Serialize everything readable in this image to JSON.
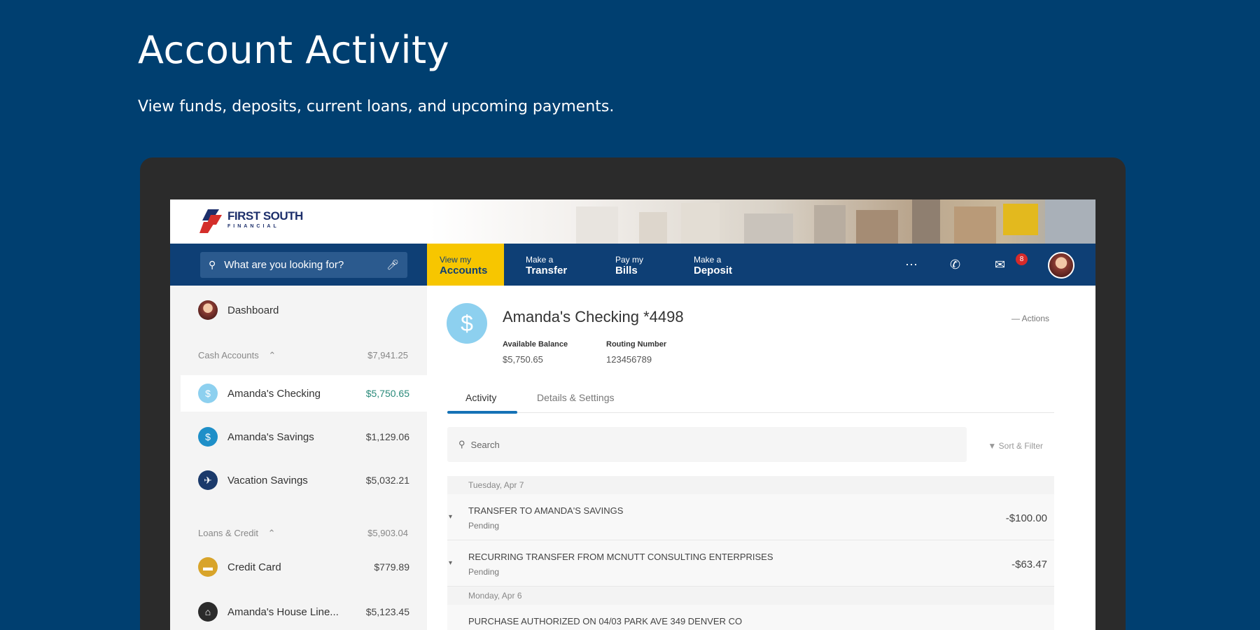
{
  "hero": {
    "title": "Account Activity",
    "subtitle": "View funds, deposits, current loans, and upcoming payments."
  },
  "brand": {
    "name": "FIRST SOUTH",
    "tagline": "FINANCIAL"
  },
  "nav": {
    "search_placeholder": "What are you looking for?",
    "items": [
      {
        "top": "View my",
        "bottom": "Accounts"
      },
      {
        "top": "Make a",
        "bottom": "Transfer"
      },
      {
        "top": "Pay my",
        "bottom": "Bills"
      },
      {
        "top": "Make a",
        "bottom": "Deposit"
      }
    ],
    "badge_count": "8"
  },
  "sidebar": {
    "dashboard": "Dashboard",
    "cash_group": {
      "label": "Cash Accounts",
      "amount": "$7,941.25"
    },
    "accounts": [
      {
        "name": "Amanda's Checking",
        "amount": "$5,750.65",
        "color": "#8dd0ef"
      },
      {
        "name": "Amanda's Savings",
        "amount": "$1,129.06",
        "color": "#1e8fc8"
      },
      {
        "name": "Vacation Savings",
        "amount": "$5,032.21",
        "color": "#1b3a6b"
      }
    ],
    "loans_group": {
      "label": "Loans & Credit",
      "amount": "$5,903.04"
    },
    "loans": [
      {
        "name": "Credit Card",
        "amount": "$779.89",
        "color": "#d8a42a"
      },
      {
        "name": "Amanda's House Line...",
        "amount": "$5,123.45",
        "color": "#2b2b2b"
      }
    ]
  },
  "account": {
    "name": "Amanda's Checking  *4498",
    "actions_label": "Actions",
    "available_label": "Available Balance",
    "available_value": "$5,750.65",
    "routing_label": "Routing Number",
    "routing_value": "123456789"
  },
  "tabs": {
    "activity": "Activity",
    "details": "Details & Settings"
  },
  "activity": {
    "search_placeholder": "Search",
    "sort_label": "Sort & Filter",
    "date1": "Tuesday, Apr 7",
    "tx": [
      {
        "desc": "TRANSFER TO AMANDA'S SAVINGS",
        "status": "Pending",
        "amount": "-$100.00"
      },
      {
        "desc": "RECURRING TRANSFER FROM MCNUTT CONSULTING ENTERPRISES",
        "status": "Pending",
        "amount": "-$63.47"
      }
    ],
    "date2": "Monday, Apr 6",
    "tx3_desc": "PURCHASE AUTHORIZED ON 04/03 PARK AVE 349 DENVER CO"
  },
  "icons": [
    "search-icon",
    "mic-icon",
    "more-icon",
    "phone-icon",
    "mail-icon",
    "dollar-icon",
    "chevron-up-icon",
    "chevron-down-icon",
    "filter-icon"
  ]
}
